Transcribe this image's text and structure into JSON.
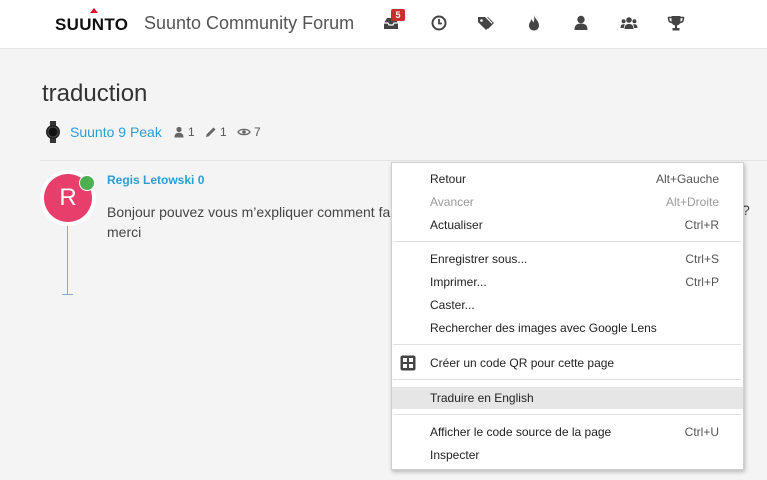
{
  "header": {
    "brand": "SUUNTO",
    "site_title": "Suunto Community Forum",
    "notification_count": "5",
    "nav_icons": [
      "notifications-icon",
      "recent-clock-icon",
      "tags-icon",
      "popular-fire-icon",
      "user-icon",
      "groups-icon",
      "trophy-icon"
    ]
  },
  "topic": {
    "title": "traduction",
    "category": "Suunto 9 Peak",
    "posters": "1",
    "posts": "1",
    "views": "7"
  },
  "post": {
    "avatar_letter": "R",
    "author": "Regis Letowski 0",
    "body_line1": "Bonjour pouvez vous m’expliquer comment fa",
    "body_line2": "merci",
    "body_trailing": "?"
  },
  "context_menu": {
    "items": [
      {
        "label": "Retour",
        "shortcut": "Alt+Gauche"
      },
      {
        "label": "Avancer",
        "shortcut": "Alt+Droite"
      },
      {
        "label": "Actualiser",
        "shortcut": "Ctrl+R"
      },
      {
        "label": "Enregistrer sous...",
        "shortcut": "Ctrl+S"
      },
      {
        "label": "Imprimer...",
        "shortcut": "Ctrl+P"
      },
      {
        "label": "Caster...",
        "shortcut": ""
      },
      {
        "label": "Rechercher des images avec Google Lens",
        "shortcut": ""
      },
      {
        "label": "Créer un code QR pour cette page",
        "shortcut": ""
      },
      {
        "label": "Traduire en English",
        "shortcut": ""
      },
      {
        "label": "Afficher le code source de la page",
        "shortcut": "Ctrl+U"
      },
      {
        "label": "Inspecter",
        "shortcut": ""
      }
    ]
  },
  "colors": {
    "accent_link": "#2a9fd6",
    "avatar_bg": "#e83e6c",
    "online": "#4caf50",
    "badge": "#c9302c",
    "brand_triangle": "#e4002b"
  }
}
